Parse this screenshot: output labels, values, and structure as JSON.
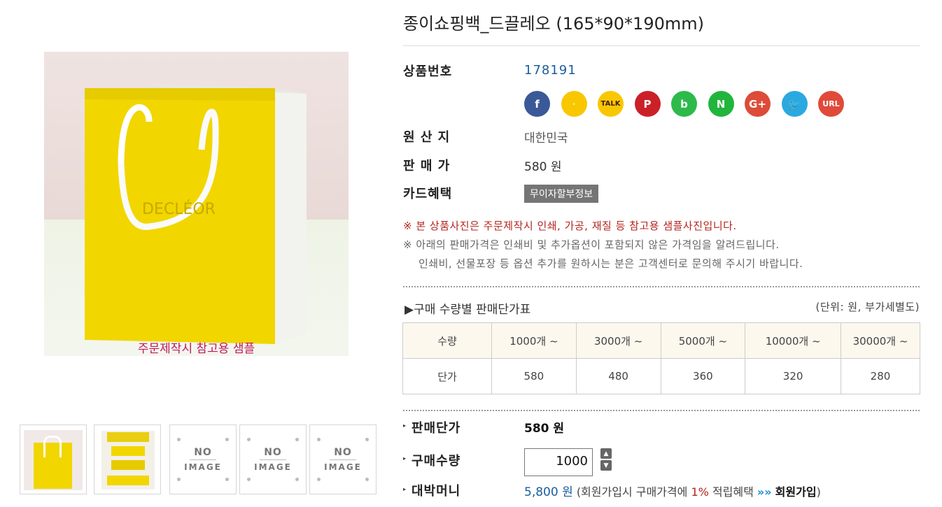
{
  "product": {
    "title": "종이쇼핑백_드끌레오 (165*90*190mm)",
    "image_caption": "주문제작시 참고용 샘플",
    "bag_brand_print": "DECLÉOR"
  },
  "info": {
    "code_label": "상품번호",
    "code_value": "178191",
    "origin_label": "원 산 지",
    "origin_value": "대한민국",
    "price_label": "판 매 가",
    "price_value": "580 원",
    "card_label": "카드혜택",
    "card_badge": "무이자할부정보"
  },
  "share": [
    {
      "name": "facebook-icon",
      "glyph": "f",
      "color": "#3b5998"
    },
    {
      "name": "kakaostory-icon",
      "glyph": "ᆞ",
      "color": "#f9c700"
    },
    {
      "name": "kakaotalk-icon",
      "glyph": "TALK",
      "color": "#f9c700"
    },
    {
      "name": "pinterest-icon",
      "glyph": "P",
      "color": "#cb2027"
    },
    {
      "name": "band-icon",
      "glyph": "b",
      "color": "#2dba4b"
    },
    {
      "name": "naver-icon",
      "glyph": "N",
      "color": "#21b53c"
    },
    {
      "name": "googleplus-icon",
      "glyph": "G+",
      "color": "#dd4b39"
    },
    {
      "name": "twitter-icon",
      "glyph": "🐦",
      "color": "#2aa9e0"
    },
    {
      "name": "url-icon",
      "glyph": "URL",
      "color": "#e04a3a"
    }
  ],
  "notes": {
    "red": "※ 본 상품사진은 주문제작시 인쇄, 가공, 재질 등 참고용 샘플사진입니다.",
    "gray1": "※ 아래의 판매가격은 인쇄비 및 추가옵션이 포함되지 않은 가격임을 알려드립니다.",
    "gray2": "인쇄비, 선물포장 등 옵션 추가를 원하시는 분은 고객센터로 문의해 주시기 바랍니다."
  },
  "price_table": {
    "heading": "▶구매 수량별 판매단가표",
    "unit_note": "(단위: 원, 부가세별도)",
    "qty_label": "수량",
    "price_label": "단가",
    "quantities": [
      "1000개 ~",
      "3000개 ~",
      "5000개 ~",
      "10000개 ~",
      "30000개 ~"
    ],
    "prices": [
      "580",
      "480",
      "360",
      "320",
      "280"
    ]
  },
  "order": {
    "unit_price_label": "판매단가",
    "unit_price_value": "580 원",
    "qty_label": "구매수량",
    "qty_value": "1000",
    "money_label": "대박머니",
    "money_value": "5,800 원",
    "money_note_pre": "(회원가입시 구매가격에",
    "money_rate": "1%",
    "money_note_mid": "적립혜택",
    "money_arrows": "»»",
    "money_join": "회원가입",
    "money_close": ")"
  },
  "thumbnails": {
    "no_image_top": "NO",
    "no_image_bottom": "IMAGE"
  },
  "colors": {
    "accent_blue": "#1a5e9c",
    "notice_red": "#b3261e",
    "caption_pink": "#c2185b",
    "bag_yellow": "#f1d600"
  }
}
